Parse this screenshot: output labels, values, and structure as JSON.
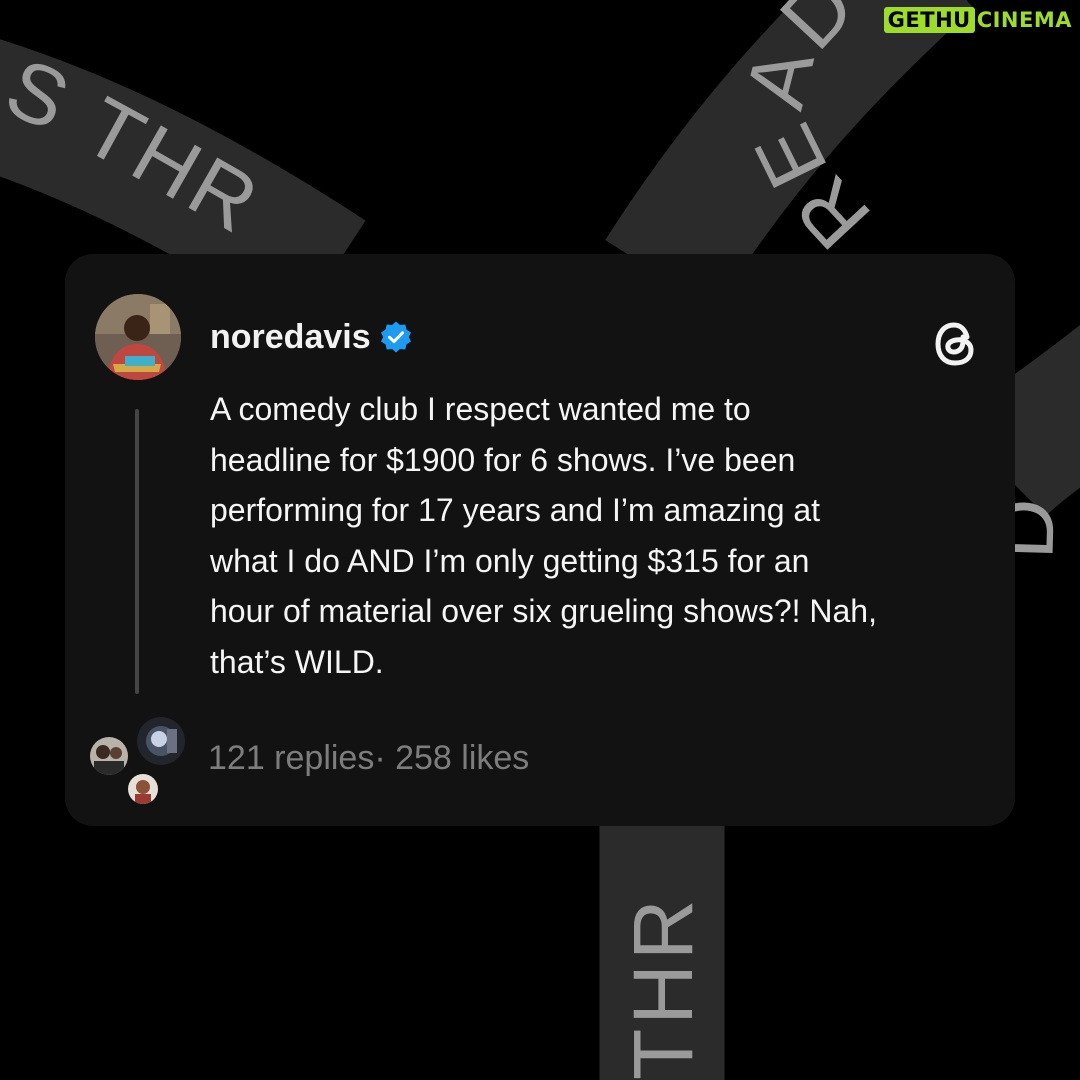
{
  "background": {
    "ribbon_texts": [
      "S THR",
      "READS",
      "D",
      "THR"
    ],
    "colors": {
      "page": "#000000",
      "ribbon": "#2b2b2b",
      "ribbon_text": "#9a9a9a"
    }
  },
  "watermark": {
    "part_a": "GETHU",
    "part_b": "CINEMA",
    "color": "#9ddc2a"
  },
  "post": {
    "username": "noredavis",
    "verified_icon": "verified-badge-icon",
    "app_icon": "threads-logo-icon",
    "text": "A comedy club I respect wanted me to\nheadline for $1900 for 6 shows.  I’ve been\nperforming for 17 years and I’m amazing at\nwhat I do AND I’m only getting $315 for an\nhour of material over six grueling shows?! Nah,\nthat’s WILD.",
    "stats": "121 replies· 258 likes",
    "colors": {
      "card": "#121212",
      "text": "#f5f5f5",
      "muted": "#7d7d7d",
      "verified": "#1d9bf0"
    }
  }
}
